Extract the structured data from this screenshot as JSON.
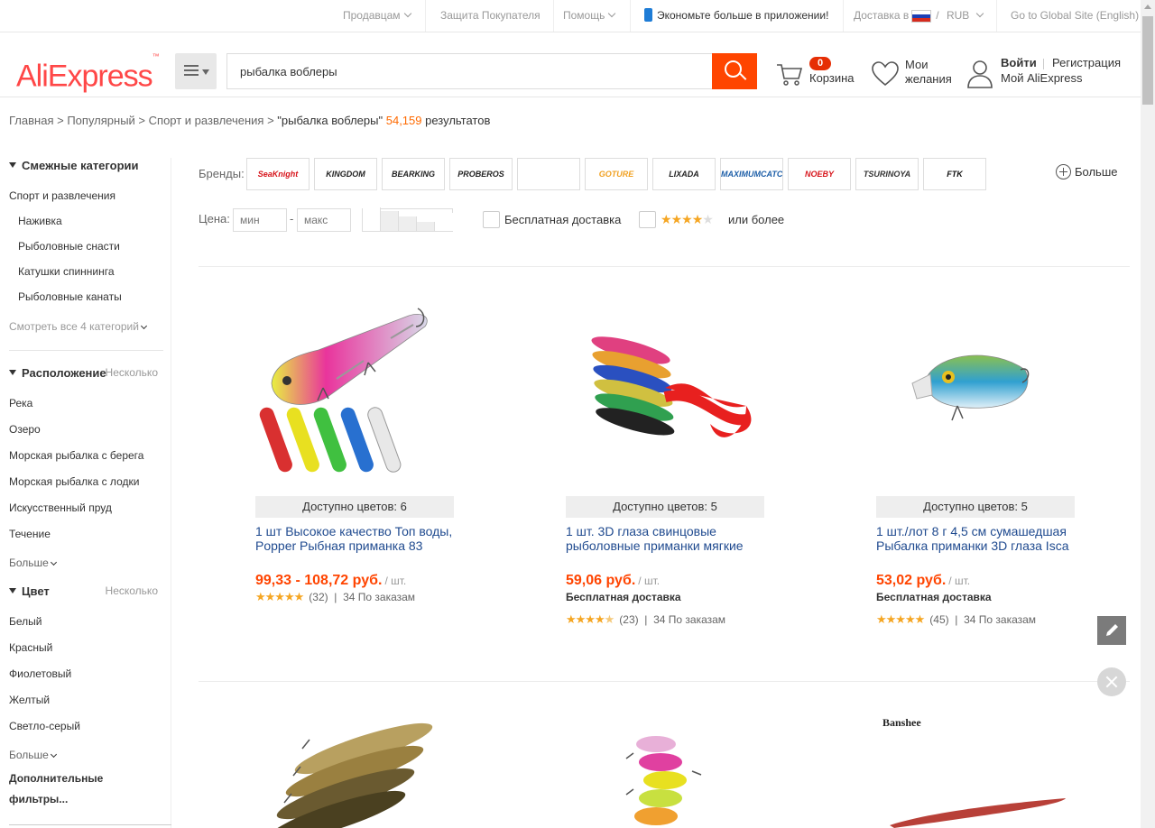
{
  "topbar": {
    "sellers": "Продавцам",
    "buyer_protection": "Защита Покупателя",
    "help": "Помощь",
    "app_promo": "Экономьте больше в приложении!",
    "delivery_to": "Доставка в",
    "currency_sep": "/",
    "currency": "RUB",
    "global_site": "Go to Global Site (English)"
  },
  "header": {
    "logo_text": "AliExpress",
    "logo_tm": "™",
    "search_value": "рыбалка воблеры",
    "cart_count": "0",
    "cart_label": "Корзина",
    "wishlist_label": "Мои желания",
    "login": "Войти",
    "register": "Регистрация",
    "my_aliexpress": "Мой AliExpress"
  },
  "breadcrumb": {
    "items": [
      "Главная",
      "Популярный",
      "Спорт и развлечения"
    ],
    "separator": ">",
    "query": "\"рыбалка воблеры\"",
    "count": "54,159",
    "results_label": "результатов"
  },
  "sidebar": {
    "related_title": "Смежные категории",
    "related_parent": "Спорт и развлечения",
    "related_items": [
      "Наживка",
      "Рыболовные снасти",
      "Катушки спиннинга",
      "Рыболовные канаты"
    ],
    "related_more": "Смотреть все 4 категорий",
    "location_title": "Расположение",
    "location_multi": "Несколько",
    "location_items": [
      "Река",
      "Озеро",
      "Морская рыбалка с берега",
      "Морская рыбалка с лодки",
      "Искусственный пруд",
      "Течение"
    ],
    "location_more": "Больше",
    "color_title": "Цвет",
    "color_multi": "Несколько",
    "color_items": [
      "Белый",
      "Красный",
      "Фиолетовый",
      "Желтый",
      "Светло-серый"
    ],
    "color_more": "Больше",
    "extra_filters": "Дополнительные фильтры..."
  },
  "filters": {
    "brands_label": "Бренды:",
    "brands": [
      {
        "name": "SeaKnight",
        "color": "#d7141b"
      },
      {
        "name": "KINGDOM",
        "color": "#222222"
      },
      {
        "name": "BEARKING",
        "color": "#222222"
      },
      {
        "name": "PROBEROS",
        "color": "#222222"
      },
      {
        "name": "",
        "color": "#222222"
      },
      {
        "name": "GOTURE",
        "color": "#f0a020"
      },
      {
        "name": "LIXADA",
        "color": "#222222"
      },
      {
        "name": "MAXIMUMCATCH",
        "color": "#1e5fa8"
      },
      {
        "name": "NOEBY",
        "color": "#d7141b"
      },
      {
        "name": "TSURINOYA",
        "color": "#333333"
      },
      {
        "name": "FTK",
        "color": "#111111"
      }
    ],
    "more_brands": "Больше",
    "price_label": "Цена:",
    "price_min_placeholder": "мин",
    "price_max_placeholder": "макс",
    "price_dash": "-",
    "free_shipping": "Бесплатная доставка",
    "rating_or_more": "или более",
    "rating_stars": 4
  },
  "products": [
    {
      "colors": "Доступно цветов: 6",
      "title": "1 шт Высокое качество Топ воды, Popper Рыбная приманка 83",
      "price": "99,33 - 108,72 руб.",
      "unit": "/ шт.",
      "free_shipping": "",
      "reviews": "(32)",
      "orders": "34 По заказам",
      "rating": 5
    },
    {
      "colors": "Доступно цветов: 5",
      "title": "1 шт. 3D глаза свинцовые рыболовные приманки мягкие",
      "price": "59,06 руб.",
      "unit": "/ шт.",
      "free_shipping": "Бесплатная доставка",
      "reviews": "(23)",
      "orders": "34 По заказам",
      "rating": 4.5
    },
    {
      "colors": "Доступно цветов: 5",
      "title": "1 шт./лот 8 г 4,5 см сумашедшая Рыбалка приманки 3D глаза Isca",
      "price": "53,02 руб.",
      "unit": "/ шт.",
      "free_shipping": "Бесплатная доставка",
      "reviews": "(45)",
      "orders": "34 По заказам",
      "rating": 5
    }
  ],
  "row2": {
    "brand_banner": "Banshee"
  },
  "colors": {
    "brand": "#ff4747",
    "search_button": "#ff4500",
    "price": "#ff4400",
    "link": "#1f4a8f",
    "star": "#f5a623",
    "count": "#ff6a00"
  }
}
